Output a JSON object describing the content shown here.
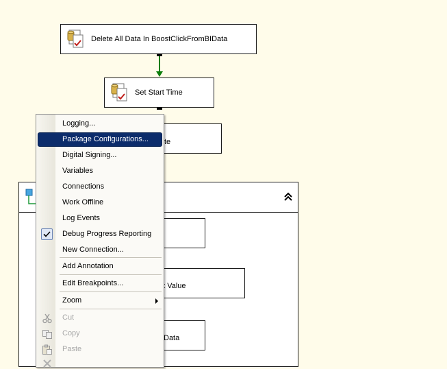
{
  "tasks": {
    "delete_all": "Delete All Data In BoostClickFromBIData",
    "set_start_time": "Set Start Time",
    "partial_1": "te",
    "partial_2": "nt Value",
    "partial_3": "Data"
  },
  "icons": {
    "task": "execute-sql-task-icon",
    "collapse": "double-chevron-up-icon",
    "check": "checkmark-icon",
    "submenu": "submenu-arrow-icon"
  },
  "colors": {
    "canvas": "#fffcea",
    "connector_success": "#0a7d0a",
    "menu_highlight": "#0c2c6b"
  },
  "context_menu": {
    "items": [
      {
        "label": "Logging..."
      },
      {
        "label": "Package Configurations...",
        "highlighted": true
      },
      {
        "label": "Digital Signing..."
      },
      {
        "label": "Variables"
      },
      {
        "label": "Connections"
      },
      {
        "label": "Work Offline"
      },
      {
        "label": "Log Events"
      },
      {
        "label": "Debug Progress Reporting",
        "checked": true
      },
      {
        "label": "New Connection..."
      },
      {
        "label": "Add Annotation"
      },
      {
        "label": "Edit Breakpoints..."
      },
      {
        "label": "Zoom",
        "has_submenu": true
      },
      {
        "label": "Cut",
        "disabled": true
      },
      {
        "label": "Copy",
        "disabled": true
      },
      {
        "label": "Paste",
        "disabled": true
      }
    ]
  }
}
